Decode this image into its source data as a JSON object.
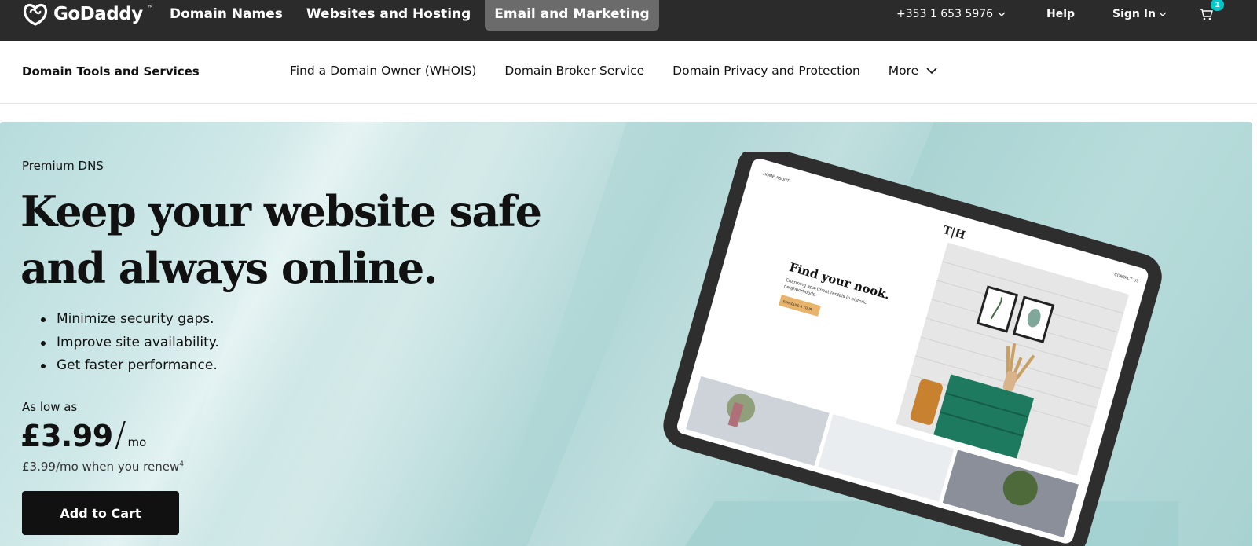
{
  "header": {
    "brand": "GoDaddy",
    "nav": [
      {
        "label": "Domain Names"
      },
      {
        "label": "Websites and Hosting"
      },
      {
        "label": "Email and Marketing"
      }
    ],
    "phone": "+353 1 653 5976",
    "help": "Help",
    "sign_in": "Sign In",
    "cart_count": "1"
  },
  "subnav": {
    "title": "Domain Tools and Services",
    "links": [
      {
        "label": "Find a Domain Owner (WHOIS)"
      },
      {
        "label": "Domain Broker Service"
      },
      {
        "label": "Domain Privacy and Protection"
      },
      {
        "label": "More"
      }
    ]
  },
  "hero": {
    "eyebrow": "Premium DNS",
    "headline": "Keep your website safe and always online.",
    "bullets": [
      "Minimize security gaps.",
      "Improve site availability.",
      "Get faster performance."
    ],
    "price_prefix": "As low as",
    "price": "£3.99",
    "price_slash": "/",
    "price_unit": "mo",
    "renew_text": "£3.99/mo when you renew",
    "renew_footnote": "4",
    "cta": "Add to Cart"
  },
  "tablet_screen": {
    "nav_home": "HOME",
    "nav_about": "ABOUT",
    "nav_contact": "CONTACT US",
    "logo": "T|H",
    "heading": "Find your nook.",
    "subtext_line1": "Charming apartment rentals in historic",
    "subtext_line2": "neighborhoods.",
    "button": "SCHEDULE A TOUR"
  },
  "colors": {
    "topbar": "#2b2b2b",
    "active_nav": "#6b6b6b",
    "hero_bg": "#b0d6d6",
    "cta_bg": "#111111",
    "badge": "#00c9c9"
  }
}
